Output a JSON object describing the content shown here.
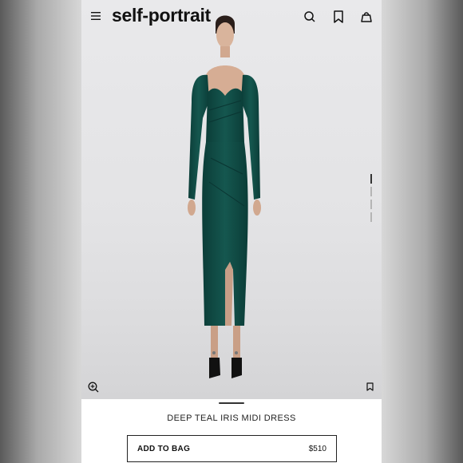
{
  "brand": {
    "logo_text": "self-portrait"
  },
  "header": {
    "icons": [
      "menu-icon",
      "search-icon",
      "bookmark-icon",
      "bag-icon"
    ]
  },
  "gallery": {
    "image_count": 3,
    "active_index": 1,
    "icons": [
      "zoom-icon",
      "bookmark-icon"
    ]
  },
  "product": {
    "name": "DEEP TEAL IRIS MIDI DRESS",
    "add_to_bag_label": "ADD TO BAG",
    "price": "$510"
  },
  "colors": {
    "dress": "#0f4a44",
    "background": "#e4e4e6",
    "text": "#111111"
  }
}
